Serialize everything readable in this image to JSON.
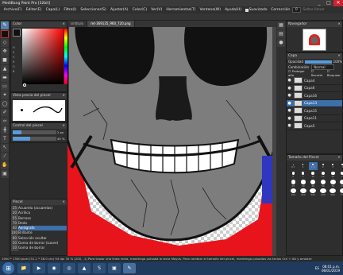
{
  "window": {
    "title": "MediBang Paint Pro [32bit]",
    "controls": [
      "_",
      "□",
      "✕"
    ]
  },
  "menubar": {
    "items": [
      "Archivo(F)",
      "Editar(E)",
      "Capa(L)",
      "Filtro(I)",
      "Seleccionar(S)",
      "Ajustar(A)",
      "Color(C)",
      "Ver(V)",
      "Herramientas(T)",
      "Ventana(W)",
      "Ayuda(H)"
    ],
    "antialias_label": "Suavizado",
    "correction_label": "Corrección",
    "correction_value": "0",
    "brush_mode_label": "Soltar llenar"
  },
  "doctabs": [
    "sintitulo",
    "ret-369135_960_720.png"
  ],
  "color_panel": {
    "title": "Color",
    "fg_color": "#111111",
    "bg_color": "#ffffff",
    "hue": "#ff0000"
  },
  "brush_preview": {
    "title": "Vista previa del pincel"
  },
  "brush_control": {
    "title": "Control del pincel",
    "size_value": "2 px",
    "opacity_value": "40 %"
  },
  "brush_list": {
    "title": "Pincel",
    "items": [
      {
        "num": "25",
        "name": "Acuarela (acuarelas)"
      },
      {
        "num": "20",
        "name": "Acrílico"
      },
      {
        "num": "55",
        "name": "Borroso"
      },
      {
        "num": "70",
        "name": "Dedo"
      },
      {
        "num": "40",
        "name": "Aerógrafo"
      },
      {
        "num": "100",
        "name": "Brillante"
      },
      {
        "num": "80",
        "name": "Selección ocultar"
      },
      {
        "num": "50",
        "name": "Goma de borrar (suave)"
      },
      {
        "num": "10",
        "name": "Goma de borrar"
      }
    ],
    "selected_index": 4
  },
  "navigator": {
    "title": "Navegador"
  },
  "layer_panel": {
    "title": "Capa",
    "opacity_label": "Opacidad",
    "opacity_value": "100%",
    "blend_label": "Combinación",
    "blend_value": "Normal",
    "protect_label": "Proteger alfa",
    "clipping_label": "Recorte",
    "lock_label": "Bloquear",
    "layers": [
      "Capa4",
      "Capa6",
      "Capa16",
      "Capa13",
      "Capa15",
      "Capa11",
      "Capa5"
    ],
    "selected_index": 3
  },
  "brush_size": {
    "title": "Tamaño del Pincel",
    "sizes": [
      "0.7",
      "1",
      "1.5",
      "2",
      "3",
      "4",
      "5",
      "7",
      "10",
      "12",
      "15",
      "20",
      "25",
      "30",
      "40",
      "50",
      "70",
      "100",
      "150",
      "200",
      "300",
      "400",
      "500",
      "700"
    ],
    "selected_index": 2
  },
  "status": {
    "text": "1900 * 1350 pixel  (51.1 * 38.0 cm)  94 dpi  35 %  (200, -1)  Para trazar una línea recta, mantenga pulsada la tecla Mayús. Para cambiar el tamaño del pincel, mantenga pulsadas las teclas Ctrl + Alt y arrastre"
  },
  "taskbar": {
    "start": "⊞",
    "time": "08:01 p.m.",
    "date": "06/01/2019",
    "lang": "ES"
  }
}
